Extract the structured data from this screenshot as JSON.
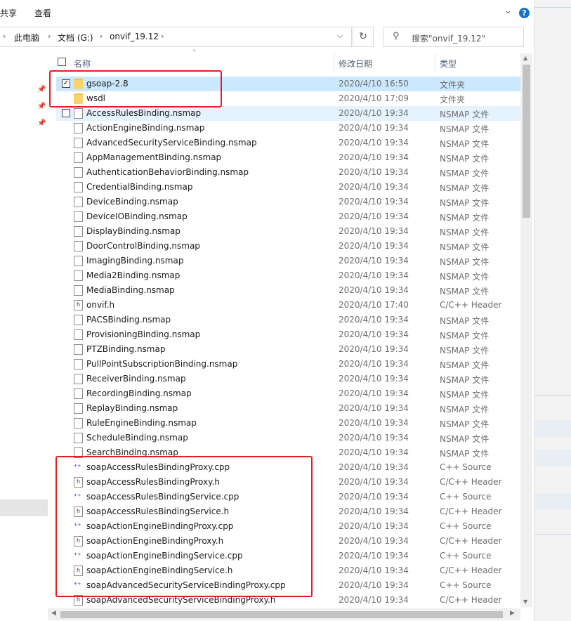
{
  "ribbon": {
    "share": "共享",
    "view": "查看"
  },
  "address": {
    "crumbs": [
      "此电脑",
      "文档 (G:)",
      "onvif_19.12"
    ]
  },
  "search": {
    "placeholder": "搜索\"onvif_19.12\""
  },
  "columns": {
    "name": "名称",
    "date": "修改日期",
    "type": "类型"
  },
  "files": [
    {
      "name": "gsoap-2.8",
      "date": "2020/4/10 16:50",
      "type": "文件夹",
      "icon": "folder-icon",
      "checked": true
    },
    {
      "name": "wsdl",
      "date": "2020/4/10 17:09",
      "type": "文件夹",
      "icon": "folder-icon"
    },
    {
      "name": "AccessRulesBinding.nsmap",
      "date": "2020/4/10 19:34",
      "type": "NSMAP 文件",
      "icon": "nsmap-file-icon",
      "checkbox": true
    },
    {
      "name": "ActionEngineBinding.nsmap",
      "date": "2020/4/10 19:34",
      "type": "NSMAP 文件",
      "icon": "nsmap-file-icon"
    },
    {
      "name": "AdvancedSecurityServiceBinding.nsmap",
      "date": "2020/4/10 19:34",
      "type": "NSMAP 文件",
      "icon": "nsmap-file-icon"
    },
    {
      "name": "AppManagementBinding.nsmap",
      "date": "2020/4/10 19:34",
      "type": "NSMAP 文件",
      "icon": "nsmap-file-icon"
    },
    {
      "name": "AuthenticationBehaviorBinding.nsmap",
      "date": "2020/4/10 19:34",
      "type": "NSMAP 文件",
      "icon": "nsmap-file-icon"
    },
    {
      "name": "CredentialBinding.nsmap",
      "date": "2020/4/10 19:34",
      "type": "NSMAP 文件",
      "icon": "nsmap-file-icon"
    },
    {
      "name": "DeviceBinding.nsmap",
      "date": "2020/4/10 19:34",
      "type": "NSMAP 文件",
      "icon": "nsmap-file-icon"
    },
    {
      "name": "DeviceIOBinding.nsmap",
      "date": "2020/4/10 19:34",
      "type": "NSMAP 文件",
      "icon": "nsmap-file-icon"
    },
    {
      "name": "DisplayBinding.nsmap",
      "date": "2020/4/10 19:34",
      "type": "NSMAP 文件",
      "icon": "nsmap-file-icon"
    },
    {
      "name": "DoorControlBinding.nsmap",
      "date": "2020/4/10 19:34",
      "type": "NSMAP 文件",
      "icon": "nsmap-file-icon"
    },
    {
      "name": "ImagingBinding.nsmap",
      "date": "2020/4/10 19:34",
      "type": "NSMAP 文件",
      "icon": "nsmap-file-icon"
    },
    {
      "name": "Media2Binding.nsmap",
      "date": "2020/4/10 19:34",
      "type": "NSMAP 文件",
      "icon": "nsmap-file-icon"
    },
    {
      "name": "MediaBinding.nsmap",
      "date": "2020/4/10 19:34",
      "type": "NSMAP 文件",
      "icon": "nsmap-file-icon"
    },
    {
      "name": "onvif.h",
      "date": "2020/4/10 17:40",
      "type": "C/C++ Header",
      "icon": "header-file-icon"
    },
    {
      "name": "PACSBinding.nsmap",
      "date": "2020/4/10 19:34",
      "type": "NSMAP 文件",
      "icon": "nsmap-file-icon"
    },
    {
      "name": "ProvisioningBinding.nsmap",
      "date": "2020/4/10 19:34",
      "type": "NSMAP 文件",
      "icon": "nsmap-file-icon"
    },
    {
      "name": "PTZBinding.nsmap",
      "date": "2020/4/10 19:34",
      "type": "NSMAP 文件",
      "icon": "nsmap-file-icon"
    },
    {
      "name": "PullPointSubscriptionBinding.nsmap",
      "date": "2020/4/10 19:34",
      "type": "NSMAP 文件",
      "icon": "nsmap-file-icon"
    },
    {
      "name": "ReceiverBinding.nsmap",
      "date": "2020/4/10 19:34",
      "type": "NSMAP 文件",
      "icon": "nsmap-file-icon"
    },
    {
      "name": "RecordingBinding.nsmap",
      "date": "2020/4/10 19:34",
      "type": "NSMAP 文件",
      "icon": "nsmap-file-icon"
    },
    {
      "name": "ReplayBinding.nsmap",
      "date": "2020/4/10 19:34",
      "type": "NSMAP 文件",
      "icon": "nsmap-file-icon"
    },
    {
      "name": "RuleEngineBinding.nsmap",
      "date": "2020/4/10 19:34",
      "type": "NSMAP 文件",
      "icon": "nsmap-file-icon"
    },
    {
      "name": "ScheduleBinding.nsmap",
      "date": "2020/4/10 19:34",
      "type": "NSMAP 文件",
      "icon": "nsmap-file-icon"
    },
    {
      "name": "SearchBinding.nsmap",
      "date": "2020/4/10 19:34",
      "type": "NSMAP 文件",
      "icon": "nsmap-file-icon"
    },
    {
      "name": "soapAccessRulesBindingProxy.cpp",
      "date": "2020/4/10 19:34",
      "type": "C++ Source",
      "icon": "cpp-file-icon"
    },
    {
      "name": "soapAccessRulesBindingProxy.h",
      "date": "2020/4/10 19:34",
      "type": "C/C++ Header",
      "icon": "header-file-icon"
    },
    {
      "name": "soapAccessRulesBindingService.cpp",
      "date": "2020/4/10 19:34",
      "type": "C++ Source",
      "icon": "cpp-file-icon"
    },
    {
      "name": "soapAccessRulesBindingService.h",
      "date": "2020/4/10 19:34",
      "type": "C/C++ Header",
      "icon": "header-file-icon"
    },
    {
      "name": "soapActionEngineBindingProxy.cpp",
      "date": "2020/4/10 19:34",
      "type": "C++ Source",
      "icon": "cpp-file-icon"
    },
    {
      "name": "soapActionEngineBindingProxy.h",
      "date": "2020/4/10 19:34",
      "type": "C/C++ Header",
      "icon": "header-file-icon"
    },
    {
      "name": "soapActionEngineBindingService.cpp",
      "date": "2020/4/10 19:34",
      "type": "C++ Source",
      "icon": "cpp-file-icon"
    },
    {
      "name": "soapActionEngineBindingService.h",
      "date": "2020/4/10 19:34",
      "type": "C/C++ Header",
      "icon": "header-file-icon"
    },
    {
      "name": "soapAdvancedSecurityServiceBindingProxy.cpp",
      "date": "2020/4/10 19:34",
      "type": "C++ Source",
      "icon": "cpp-file-icon"
    },
    {
      "name": "soapAdvancedSecurityServiceBindingProxy.h",
      "date": "2020/4/10 19:34",
      "type": "C/C++ Header",
      "icon": "header-file-icon"
    }
  ],
  "colors": {
    "selection": "#cce8ff",
    "hover": "#e5f3ff",
    "highlight_box": "#e0201c",
    "folder": "#f8d56b"
  }
}
